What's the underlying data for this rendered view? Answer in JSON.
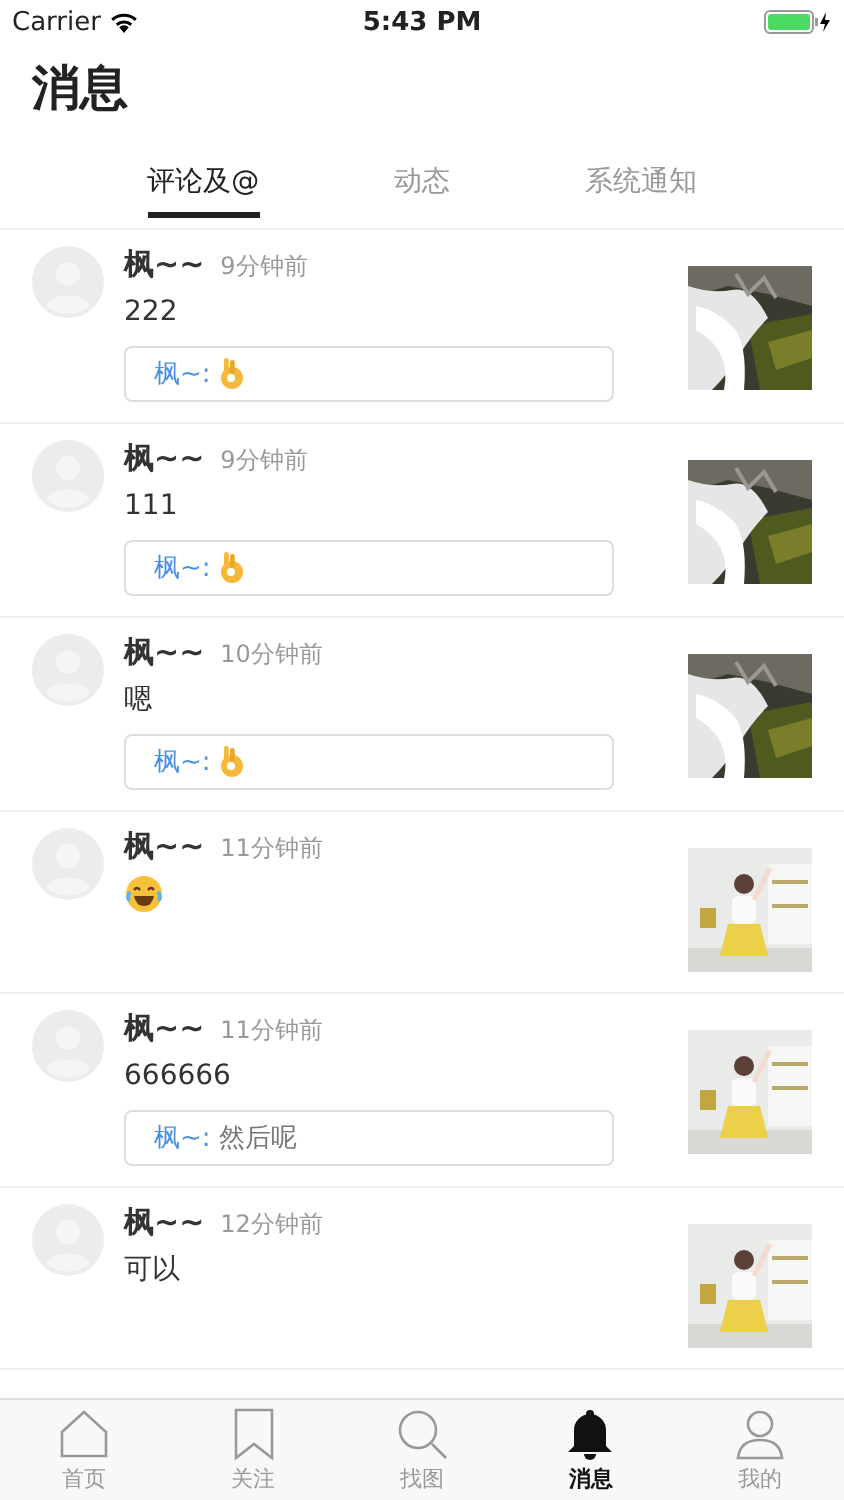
{
  "status_bar": {
    "carrier": "Carrier",
    "time": "5:43 PM"
  },
  "title": "消息",
  "tabs": [
    {
      "label": "评论及@",
      "selected": true
    },
    {
      "label": "动态",
      "selected": false
    },
    {
      "label": "系统通知",
      "selected": false
    }
  ],
  "messages": [
    {
      "name": "枫~~",
      "time": "9分钟前",
      "content": {
        "kind": "text",
        "text": "222"
      },
      "reply": {
        "author": "枫~:",
        "kind": "emoji"
      },
      "thumbnail": {
        "kind": "waterfall"
      }
    },
    {
      "name": "枫~~",
      "time": "9分钟前",
      "content": {
        "kind": "text",
        "text": "111"
      },
      "reply": {
        "author": "枫~:",
        "kind": "emoji"
      },
      "thumbnail": {
        "kind": "waterfall"
      }
    },
    {
      "name": "枫~~",
      "time": "10分钟前",
      "content": {
        "kind": "text",
        "text": "嗯"
      },
      "reply": {
        "author": "枫~:",
        "kind": "emoji"
      },
      "thumbnail": {
        "kind": "waterfall"
      }
    },
    {
      "name": "枫~~",
      "time": "11分钟前",
      "content": {
        "kind": "emoji"
      },
      "thumbnail": {
        "kind": "room"
      }
    },
    {
      "name": "枫~~",
      "time": "11分钟前",
      "content": {
        "kind": "text",
        "text": "666666"
      },
      "reply": {
        "author": "枫~:",
        "kind": "text",
        "text": "然后呢"
      },
      "thumbnail": {
        "kind": "room"
      }
    },
    {
      "name": "枫~~",
      "time": "12分钟前",
      "content": {
        "kind": "text",
        "text": "可以"
      },
      "thumbnail": {
        "kind": "room"
      }
    }
  ],
  "tab_bar": [
    {
      "label": "首页",
      "selected": false
    },
    {
      "label": "关注",
      "selected": false
    },
    {
      "label": "找图",
      "selected": false
    },
    {
      "label": "消息",
      "selected": true
    },
    {
      "label": "我的",
      "selected": false
    }
  ]
}
